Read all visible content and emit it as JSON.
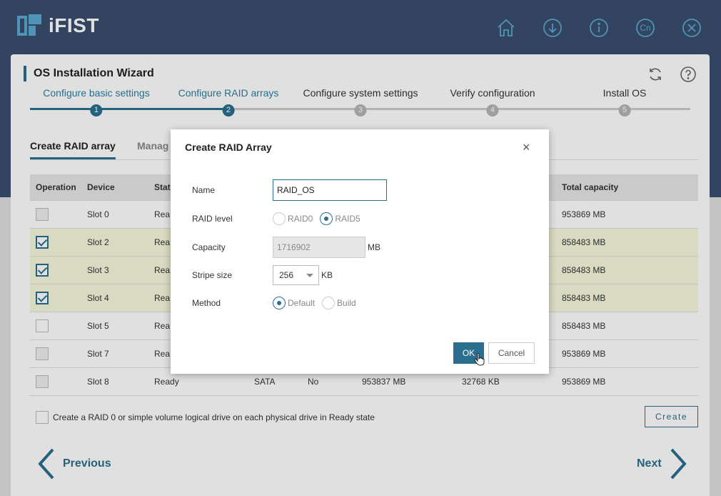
{
  "app": {
    "title": "iFIST"
  },
  "header": {
    "icons": [
      "home-icon",
      "download-icon",
      "info-icon",
      "language-icon",
      "close-icon"
    ],
    "language_label": "Cn"
  },
  "wizard": {
    "title": "OS Installation Wizard",
    "steps": [
      {
        "label": "Configure basic settings",
        "number": "1",
        "state": "done"
      },
      {
        "label": "Configure RAID arrays",
        "number": "2",
        "state": "done"
      },
      {
        "label": "Configure system settings",
        "number": "3",
        "state": "todo"
      },
      {
        "label": "Verify configuration",
        "number": "4",
        "state": "todo"
      },
      {
        "label": "Install OS",
        "number": "5",
        "state": "todo"
      }
    ]
  },
  "subtabs": {
    "create": "Create RAID array",
    "manage": "Manag"
  },
  "table": {
    "headers": [
      "Operation",
      "Device",
      "Stat",
      "",
      "",
      "",
      "",
      "Total capacity"
    ],
    "rows": [
      {
        "checked": false,
        "device": "Slot 0",
        "status": "Rea",
        "interface": "",
        "smart": "",
        "capacity": "",
        "cache": "",
        "total": "953869 MB"
      },
      {
        "checked": true,
        "device": "Slot 2",
        "status": "Rea",
        "interface": "",
        "smart": "",
        "capacity": "",
        "cache": "",
        "total": "858483 MB"
      },
      {
        "checked": true,
        "device": "Slot 3",
        "status": "Rea",
        "interface": "",
        "smart": "",
        "capacity": "",
        "cache": "",
        "total": "858483 MB"
      },
      {
        "checked": true,
        "device": "Slot 4",
        "status": "Rea",
        "interface": "",
        "smart": "",
        "capacity": "",
        "cache": "",
        "total": "858483 MB"
      },
      {
        "checked": false,
        "device": "Slot 5",
        "status": "Rea",
        "interface": "",
        "smart": "",
        "capacity": "",
        "cache": "",
        "total": "858483 MB"
      },
      {
        "checked": false,
        "device": "Slot 7",
        "status": "Rea",
        "interface": "",
        "smart": "",
        "capacity": "",
        "cache": "",
        "total": "953869 MB"
      },
      {
        "checked": false,
        "device": "Slot 8",
        "status": "Ready",
        "interface": "SATA",
        "smart": "No",
        "capacity": "953837 MB",
        "cache": "32768 KB",
        "total": "953869 MB"
      }
    ]
  },
  "bulk_option": {
    "label": "Create a RAID 0 or simple volume logical drive on each physical drive in Ready state",
    "checked": false
  },
  "buttons": {
    "create": "Create",
    "previous": "Previous",
    "next": "Next"
  },
  "dialog": {
    "title": "Create RAID Array",
    "close": "×",
    "name": {
      "label": "Name",
      "value": "RAID_OS"
    },
    "raid_level": {
      "label": "RAID level",
      "options": [
        "RAID0",
        "RAID5"
      ],
      "selected": "RAID5"
    },
    "capacity": {
      "label": "Capacity",
      "value": "1716902",
      "unit": "MB"
    },
    "stripe": {
      "label": "Stripe size",
      "value": "256",
      "unit": "KB"
    },
    "method": {
      "label": "Method",
      "options": [
        "Default",
        "Build"
      ],
      "selected": "Default"
    },
    "ok": "OK",
    "cancel": "Cancel"
  },
  "colors": {
    "accent": "#2a6f8e",
    "header_bg": "#3a4e6e",
    "icon": "#5aa9d0",
    "selected_row": "#f7f9dd"
  }
}
